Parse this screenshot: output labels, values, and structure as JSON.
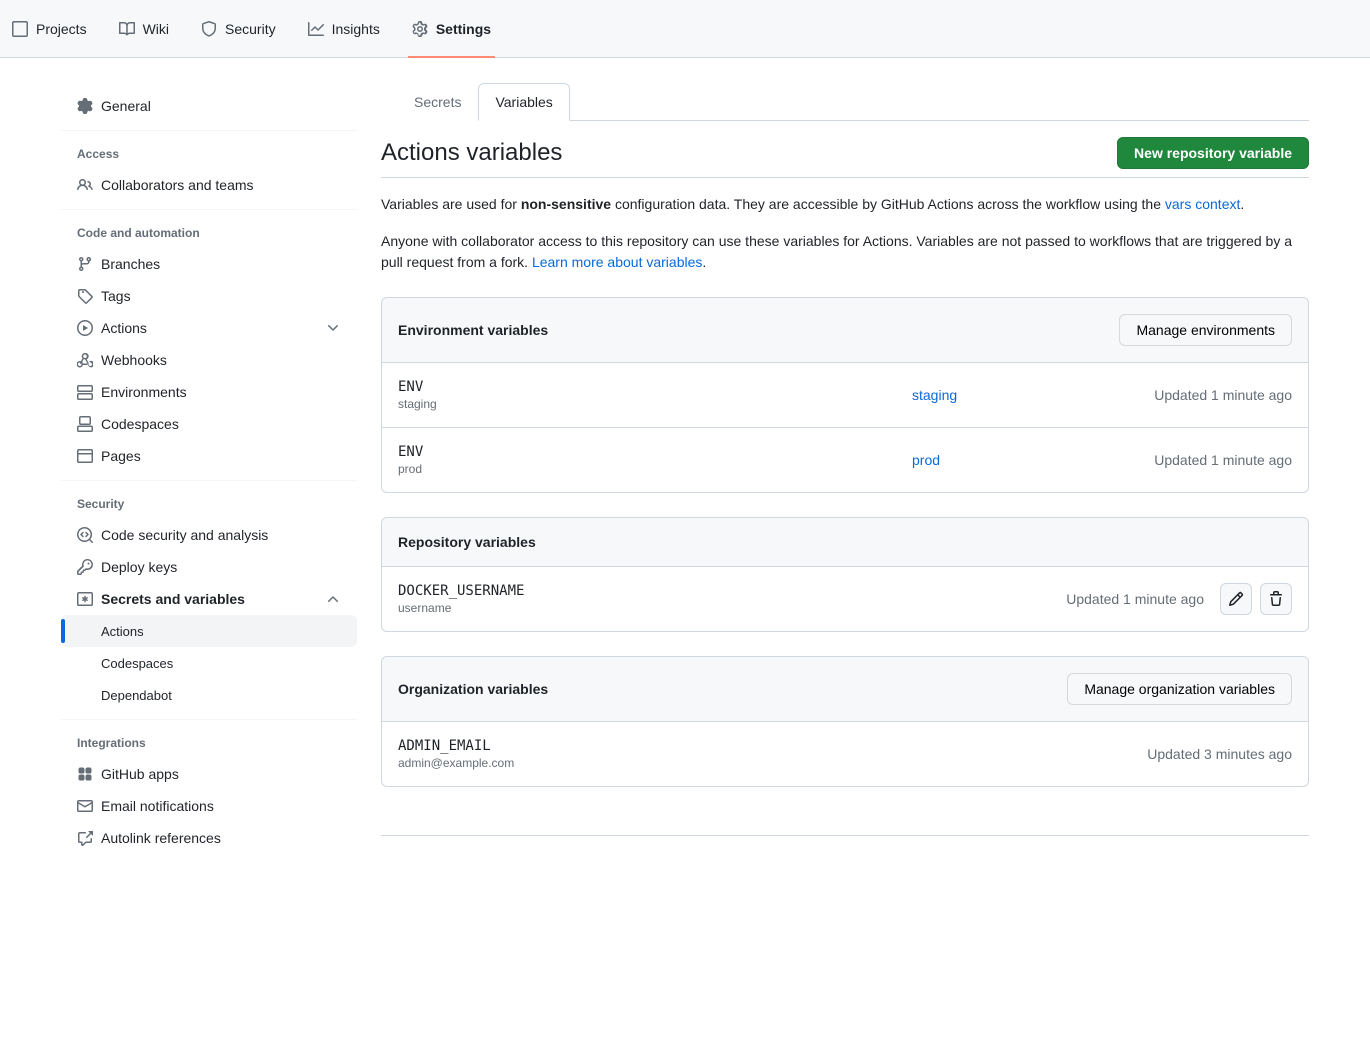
{
  "topnav": {
    "projects": "Projects",
    "wiki": "Wiki",
    "security": "Security",
    "insights": "Insights",
    "settings": "Settings"
  },
  "sidebar": {
    "general": "General",
    "access_heading": "Access",
    "collaborators": "Collaborators and teams",
    "code_heading": "Code and automation",
    "branches": "Branches",
    "tags": "Tags",
    "actions": "Actions",
    "webhooks": "Webhooks",
    "environments": "Environments",
    "codespaces": "Codespaces",
    "pages": "Pages",
    "security_heading": "Security",
    "code_security": "Code security and analysis",
    "deploy_keys": "Deploy keys",
    "secrets_variables": "Secrets and variables",
    "sub_actions": "Actions",
    "sub_codespaces": "Codespaces",
    "sub_dependabot": "Dependabot",
    "integrations_heading": "Integrations",
    "github_apps": "GitHub apps",
    "email_notifications": "Email notifications",
    "autolink": "Autolink references"
  },
  "tabs": {
    "secrets": "Secrets",
    "variables": "Variables"
  },
  "header": {
    "title": "Actions variables",
    "new_button": "New repository variable"
  },
  "description": {
    "p1_a": "Variables are used for ",
    "p1_b": "non-sensitive",
    "p1_c": " configuration data. They are accessible by GitHub Actions across the workflow using the ",
    "p1_link": "vars context",
    "p1_d": ".",
    "p2_a": "Anyone with collaborator access to this repository can use these variables for Actions. Variables are not passed to workflows that are triggered by a pull request from a fork. ",
    "p2_link": "Learn more about variables",
    "p2_b": "."
  },
  "env_panel": {
    "title": "Environment variables",
    "manage": "Manage environments",
    "rows": [
      {
        "name": "ENV",
        "value": "staging",
        "env": "staging",
        "updated": "Updated 1 minute ago"
      },
      {
        "name": "ENV",
        "value": "prod",
        "env": "prod",
        "updated": "Updated 1 minute ago"
      }
    ]
  },
  "repo_panel": {
    "title": "Repository variables",
    "rows": [
      {
        "name": "DOCKER_USERNAME",
        "value": "username",
        "updated": "Updated 1 minute ago"
      }
    ]
  },
  "org_panel": {
    "title": "Organization variables",
    "manage": "Manage organization variables",
    "rows": [
      {
        "name": "ADMIN_EMAIL",
        "value": "admin@example.com",
        "updated": "Updated 3 minutes ago"
      }
    ]
  }
}
